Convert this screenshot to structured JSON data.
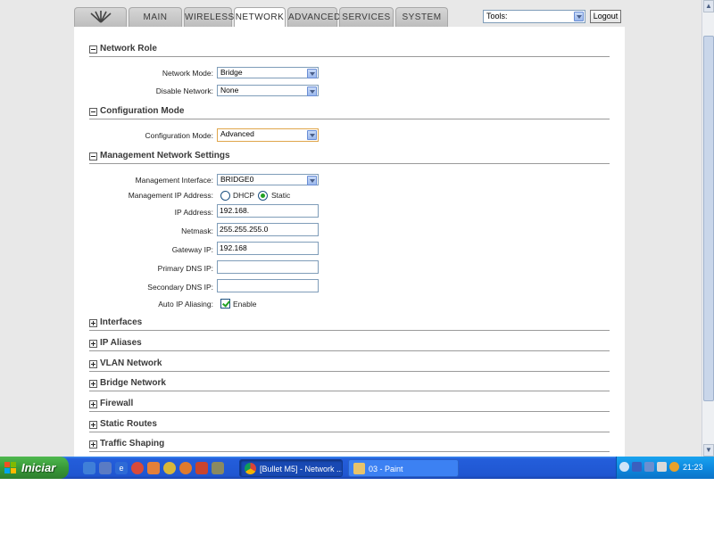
{
  "tabs": {
    "main": "MAIN",
    "wireless": "WIRELESS",
    "network": "NETWORK",
    "advanced": "ADVANCED",
    "services": "SERVICES",
    "system": "SYSTEM"
  },
  "tools": {
    "selected": "Tools:"
  },
  "logout_label": "Logout",
  "sections": {
    "network_role": "Network Role",
    "configuration_mode": "Configuration Mode",
    "management_network": "Management Network Settings",
    "interfaces": "Interfaces",
    "ip_aliases": "IP Aliases",
    "vlan_network": "VLAN Network",
    "bridge_network": "Bridge Network",
    "firewall": "Firewall",
    "static_routes": "Static Routes",
    "traffic_shaping": "Traffic Shaping"
  },
  "network_role": {
    "network_mode_label": "Network Mode:",
    "network_mode_value": "Bridge",
    "disable_network_label": "Disable Network:",
    "disable_network_value": "None"
  },
  "configuration_mode": {
    "label": "Configuration Mode:",
    "value": "Advanced"
  },
  "management": {
    "interface_label": "Management Interface:",
    "interface_value": "BRIDGE0",
    "ip_address_mode_label": "Management IP Address:",
    "dhcp_label": "DHCP",
    "static_label": "Static",
    "selected_mode": "Static",
    "ip_address_label": "IP Address:",
    "ip_address_value": "192.168.",
    "netmask_label": "Netmask:",
    "netmask_value": "255.255.255.0",
    "gateway_label": "Gateway IP:",
    "gateway_value": "192.168",
    "primary_dns_label": "Primary DNS IP:",
    "primary_dns_value": "",
    "secondary_dns_label": "Secondary DNS IP:",
    "secondary_dns_value": "",
    "auto_ip_label": "Auto IP Aliasing:",
    "auto_ip_enable_label": "Enable",
    "auto_ip_checked": true
  },
  "taskbar": {
    "start_label": "Iniciar",
    "tasks": [
      {
        "label": "[Bullet M5] - Network ...",
        "icon": "chrome-icon",
        "active": true
      },
      {
        "label": "03 - Paint",
        "icon": "paint-icon",
        "active": false
      }
    ],
    "clock": "21:23"
  }
}
